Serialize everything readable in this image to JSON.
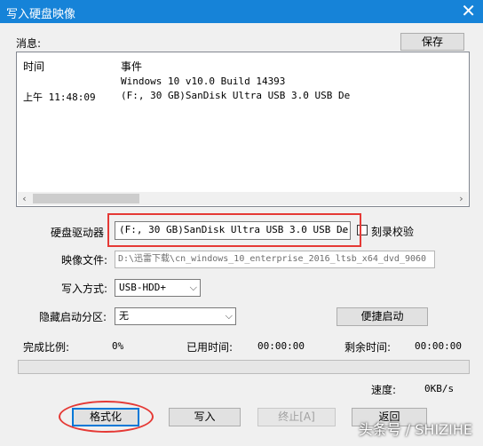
{
  "window": {
    "title": "写入硬盘映像",
    "close_glyph": "✕"
  },
  "messages": {
    "label": "消息:",
    "save_button": "保存",
    "col_time": "时间",
    "col_event": "事件",
    "rows": [
      {
        "time": "",
        "event": "Windows 10 v10.0 Build 14393"
      },
      {
        "time": "上午 11:48:09",
        "event": "(F:, 30 GB)SanDisk Ultra USB 3.0 USB De"
      }
    ]
  },
  "drive": {
    "label": "硬盘驱动器",
    "value": "(F:, 30 GB)SanDisk Ultra USB 3.0 USB De",
    "verify_label": "刻录校验",
    "verify_checked": false
  },
  "image_file": {
    "label": "映像文件:",
    "value": "D:\\迅雷下载\\cn_windows_10_enterprise_2016_ltsb_x64_dvd_9060"
  },
  "write_mode": {
    "label": "写入方式:",
    "value": "USB-HDD+"
  },
  "hidden_partition": {
    "label": "隐藏启动分区:",
    "value": "无",
    "quick_boot_button": "便捷启动"
  },
  "progress": {
    "percent_label": "完成比例:",
    "percent_value": "0%",
    "elapsed_label": "已用时间:",
    "elapsed_value": "00:00:00",
    "remaining_label": "剩余时间:",
    "remaining_value": "00:00:00",
    "speed_label": "速度:",
    "speed_value": "0KB/s",
    "fraction": 0
  },
  "actions": {
    "format": "格式化",
    "write": "写入",
    "abort": "终止[A]",
    "back": "返回"
  },
  "watermark": "头条号 / SHIZIHE",
  "colors": {
    "titlebar": "#1683d8",
    "annotation_red": "#e53935"
  }
}
